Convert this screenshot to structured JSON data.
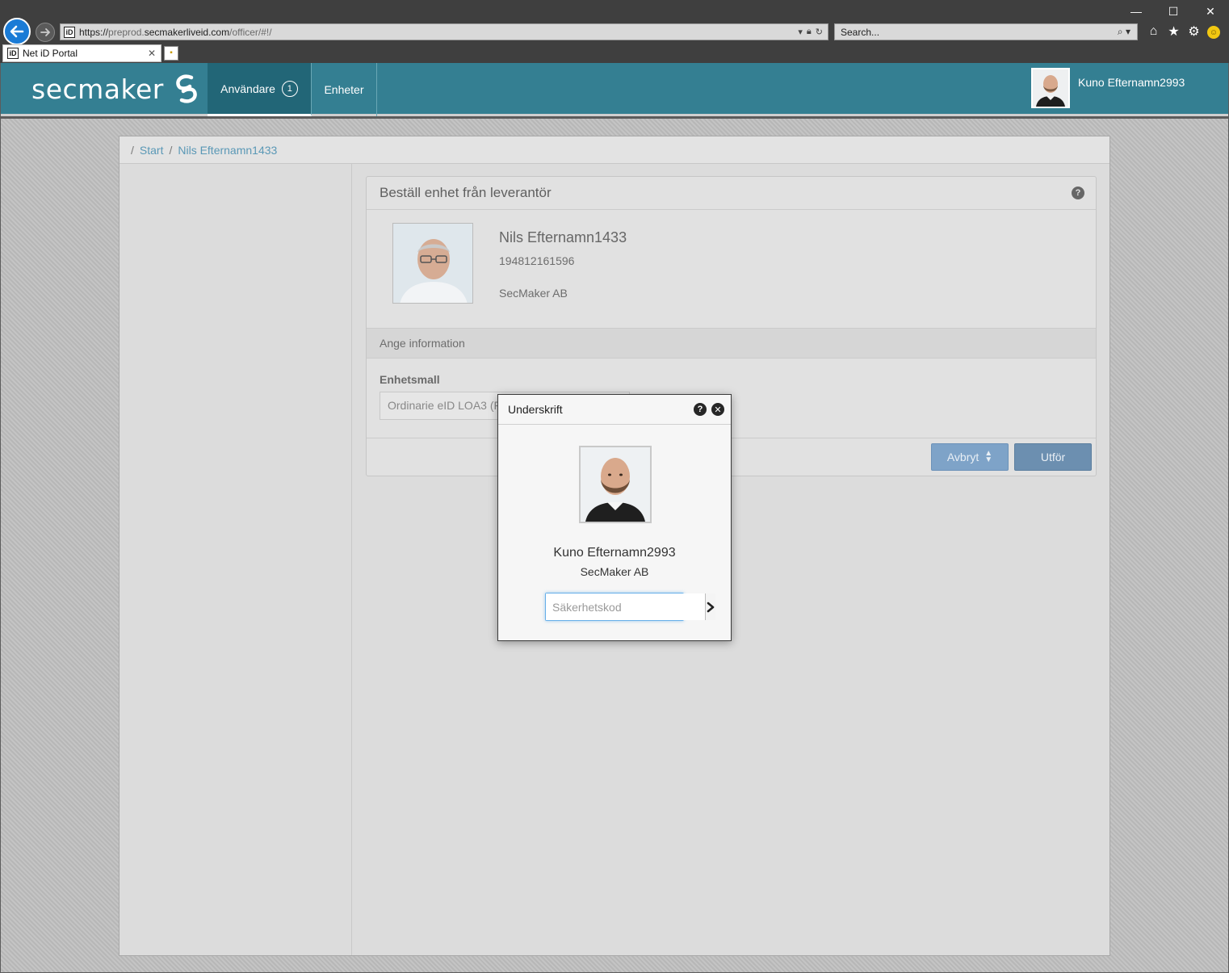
{
  "browser": {
    "url_prefix": "https://",
    "url_domain_dim": "preprod.",
    "url_domain": "secmakerliveid.com",
    "url_path": "/officer/#!/",
    "search_placeholder": "Search...",
    "tab_title": "Net iD Portal",
    "favicon_text": "iD"
  },
  "navbar": {
    "logo_text": "secmaker",
    "items": [
      {
        "label": "Användare",
        "badge": "1"
      },
      {
        "label": "Enheter"
      }
    ],
    "user_name": "Kuno Efternamn2993"
  },
  "breadcrumb": {
    "items": [
      "Start",
      "Nils Efternamn1433"
    ]
  },
  "panel": {
    "title": "Beställ enhet från leverantör",
    "person": {
      "name": "Nils Efternamn1433",
      "id": "194812161596",
      "org": "SecMaker AB"
    },
    "subheading": "Ange information",
    "field_label": "Enhetsmall",
    "field_value": "Ordinarie eID LOA3 (FS",
    "cancel_label": "Avbryt",
    "submit_label": "Utför"
  },
  "dialog": {
    "title": "Underskrift",
    "name": "Kuno Efternamn2993",
    "org": "SecMaker AB",
    "pin_placeholder": "Säkerhetskod"
  },
  "colors": {
    "navbar": "#347f92",
    "nav_active": "#226677",
    "link": "#5a98b6",
    "button_cancel": "#7ea3c8",
    "button_submit": "#6c8fb0"
  }
}
